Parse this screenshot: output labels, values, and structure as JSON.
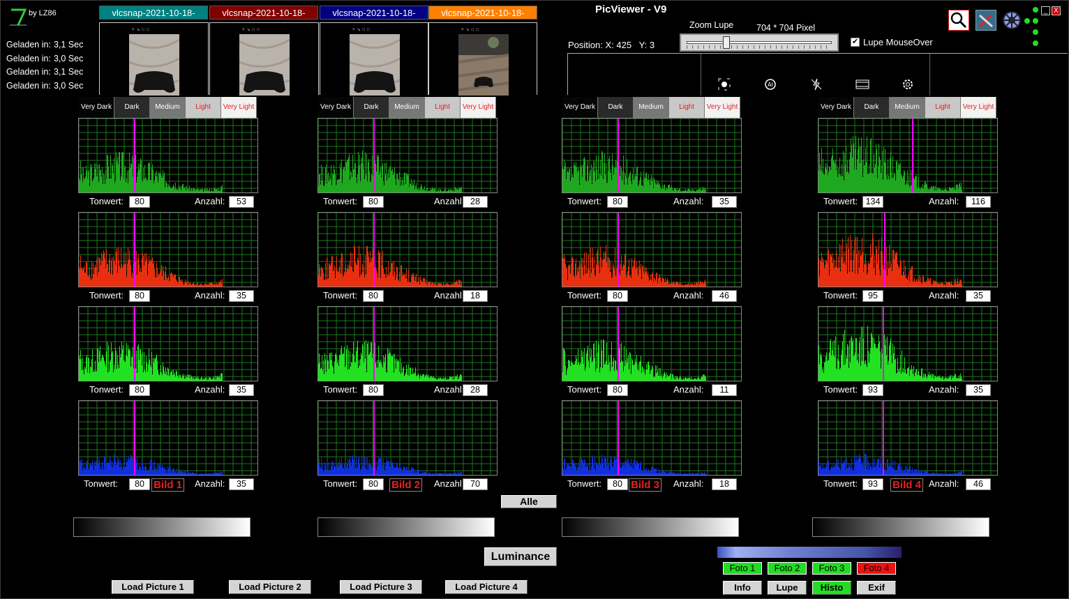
{
  "app": {
    "title": "PicViewer - V9",
    "by": "by LZ86"
  },
  "loaded": [
    {
      "label": "Geladen in:",
      "value": "3,1 Sec"
    },
    {
      "label": "Geladen in:",
      "value": "3,0 Sec"
    },
    {
      "label": "Geladen in:",
      "value": "3,1 Sec"
    },
    {
      "label": "Geladen in:",
      "value": "3,0 Sec"
    }
  ],
  "tabs": [
    {
      "label": "vlcsnap-2021-10-18-",
      "color": "#008080"
    },
    {
      "label": "vlcsnap-2021-10-18-",
      "color": "#800000"
    },
    {
      "label": "vlcsnap-2021-10-18-",
      "color": "#000080"
    },
    {
      "label": "vlcsnap-2021-10-18-",
      "color": "#ff8000"
    }
  ],
  "position": {
    "text": "Position: X: 425   Y: 3"
  },
  "zoom": {
    "label": "Zoom Lupe",
    "pixels": "704 * 704 Pixel"
  },
  "lupe_mouseover": {
    "label": "Lupe MouseOver",
    "checked": true,
    "mark": "✔"
  },
  "window_controls": {
    "minimize": "_",
    "close": "X"
  },
  "tone_labels": [
    "Very Dark",
    "Dark",
    "Medium",
    "Light",
    "Very Light"
  ],
  "labels": {
    "tonwert": "Tonwert:",
    "anzahl": "Anzahl:"
  },
  "columns": [
    {
      "bild": "Bild 1",
      "rows": [
        {
          "channel": "luma",
          "tonwert": "80",
          "anzahl": "53"
        },
        {
          "channel": "red",
          "tonwert": "80",
          "anzahl": "35"
        },
        {
          "channel": "green",
          "tonwert": "80",
          "anzahl": "35"
        },
        {
          "channel": "blue",
          "tonwert": "80",
          "anzahl": "35"
        }
      ]
    },
    {
      "bild": "Bild 2",
      "rows": [
        {
          "channel": "luma",
          "tonwert": "80",
          "anzahl": "28"
        },
        {
          "channel": "red",
          "tonwert": "80",
          "anzahl": "18"
        },
        {
          "channel": "green",
          "tonwert": "80",
          "anzahl": "28"
        },
        {
          "channel": "blue",
          "tonwert": "80",
          "anzahl": "70"
        }
      ]
    },
    {
      "bild": "Bild 3",
      "rows": [
        {
          "channel": "luma",
          "tonwert": "80",
          "anzahl": "35"
        },
        {
          "channel": "red",
          "tonwert": "80",
          "anzahl": "46"
        },
        {
          "channel": "green",
          "tonwert": "80",
          "anzahl": "11"
        },
        {
          "channel": "blue",
          "tonwert": "80",
          "anzahl": "18"
        }
      ]
    },
    {
      "bild": "Bild 4",
      "rows": [
        {
          "channel": "luma",
          "tonwert": "134",
          "anzahl": "116"
        },
        {
          "channel": "red",
          "tonwert": "95",
          "anzahl": "35"
        },
        {
          "channel": "green",
          "tonwert": "93",
          "anzahl": "35"
        },
        {
          "channel": "blue",
          "tonwert": "93",
          "anzahl": "46"
        }
      ]
    }
  ],
  "buttons": {
    "alle": "Alle",
    "luminance": "Luminance",
    "load": [
      "Load Picture 1",
      "Load Picture 2",
      "Load Picture 3",
      "Load Picture 4"
    ],
    "foto": [
      {
        "label": "Foto 1",
        "color": "#22dd22"
      },
      {
        "label": "Foto 2",
        "color": "#22dd22"
      },
      {
        "label": "Foto 3",
        "color": "#22dd22"
      },
      {
        "label": "Foto 4",
        "color": "#ee1111"
      }
    ],
    "bottom": [
      {
        "label": "Info",
        "color": "#d4d4d4"
      },
      {
        "label": "Lupe",
        "color": "#d4d4d4"
      },
      {
        "label": "Histo",
        "color": "#22dd22"
      },
      {
        "label": "Exif",
        "color": "#d4d4d4"
      }
    ]
  },
  "colors": {
    "luma": "#1fa81f",
    "red": "#e83010",
    "green": "#22e022",
    "blue": "#1030e0",
    "marker": "#ff00ff",
    "grid": "#1b7a1b"
  }
}
